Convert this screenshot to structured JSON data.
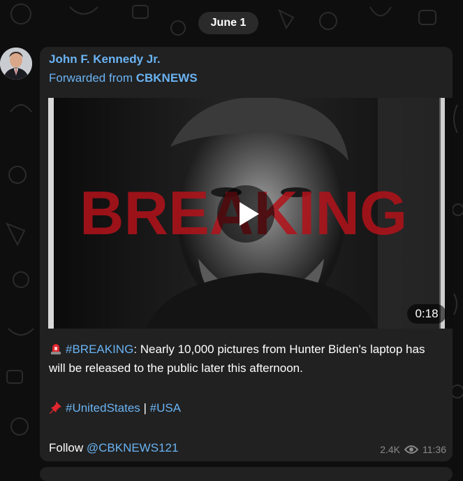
{
  "date_label": "June 1",
  "message": {
    "sender": "John F. Kennedy Jr.",
    "forwarded_prefix": "Forwarded from",
    "forwarded_source": "CBKNEWS",
    "video": {
      "overlay_text": "BREAKING",
      "duration": "0:18"
    },
    "text": {
      "hashtag_breaking": "#BREAKING",
      "body": ": Nearly 10,000 pictures from Hunter Biden's laptop has will be released to the public later this afternoon.",
      "tag_us": "#UnitedStates",
      "separator": " | ",
      "tag_usa": "#USA",
      "follow_prefix": "Follow ",
      "follow_handle": "@CBKNEWS121"
    },
    "views": "2.4K",
    "time": "11:36"
  },
  "icons": {
    "siren": "police-light-emoji",
    "pin": "pushpin-emoji",
    "views": "eye-icon",
    "play": "play-icon"
  },
  "colors": {
    "link": "#6ab3f3",
    "bubble": "#212121",
    "background": "#0e0e0e",
    "overlay_red": "#b3121a"
  }
}
